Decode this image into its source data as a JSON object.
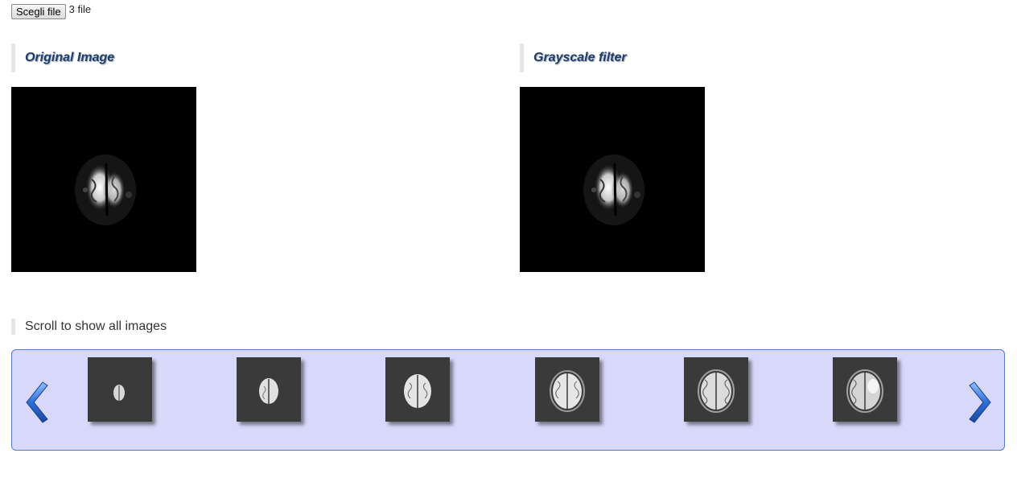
{
  "file_input": {
    "button_label": "Scegli file",
    "status": "3 file"
  },
  "panels": {
    "original_title": "Original Image",
    "grayscale_title": "Grayscale filter"
  },
  "carousel": {
    "hint": "Scroll to show all images",
    "prev_icon": "chevron-left-icon",
    "next_icon": "chevron-right-icon",
    "thumbnail_count": 6
  },
  "colors": {
    "carousel_background": "#d8d8fa",
    "carousel_border": "#5a78c8",
    "heading_text": "#1f3d6b",
    "arrow_blue": "#2f6fd6"
  }
}
